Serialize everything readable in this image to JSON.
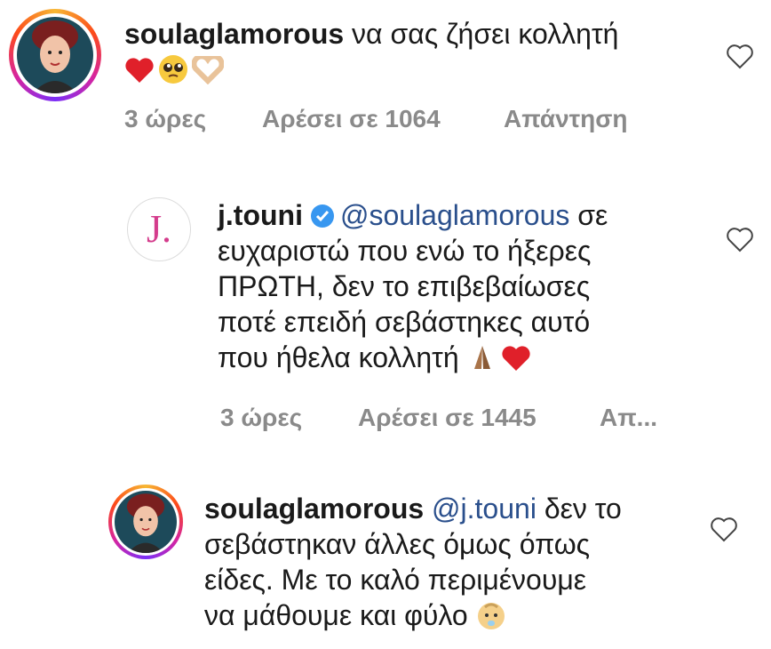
{
  "comments": [
    {
      "username": "soulaglamorous",
      "text": "να σας ζήσει κολλητή",
      "emojis": [
        "red-heart",
        "pleading-face",
        "heart-hands"
      ],
      "time": "3 ώρες",
      "likes": "Αρέσει σε 1064",
      "reply": "Απάντηση"
    },
    {
      "username": "j.touni",
      "verified": true,
      "avatar_letter": "J.",
      "mention": "@soulaglamorous",
      "line1_rest": "σε",
      "line2": "ευχαριστώ που ενώ το ήξερες",
      "line3": "ΠΡΩΤΗ, δεν το επιβεβαίωσες",
      "line4": "ποτέ επειδή σεβάστηκες αυτό",
      "line5": "που ήθελα κολλητή",
      "emojis": [
        "folded-hands",
        "red-heart"
      ],
      "time": "3 ώρες",
      "likes": "Αρέσει σε 1445",
      "reply": "Απ..."
    },
    {
      "username": "soulaglamorous",
      "mention": "@j.touni",
      "line1_rest": "δεν το",
      "line2": "σεβάστηκαν άλλες όμως όπως",
      "line3": "είδες. Με το καλό περιμένουμε",
      "line4": "να μάθουμε και φύλο",
      "emojis": [
        "baby-face"
      ]
    }
  ],
  "colors": {
    "brand_pink": "#d43c8c",
    "mention_blue": "#2a4f8c",
    "meta_gray": "#8a8a8a",
    "verified_blue": "#3897f0"
  }
}
